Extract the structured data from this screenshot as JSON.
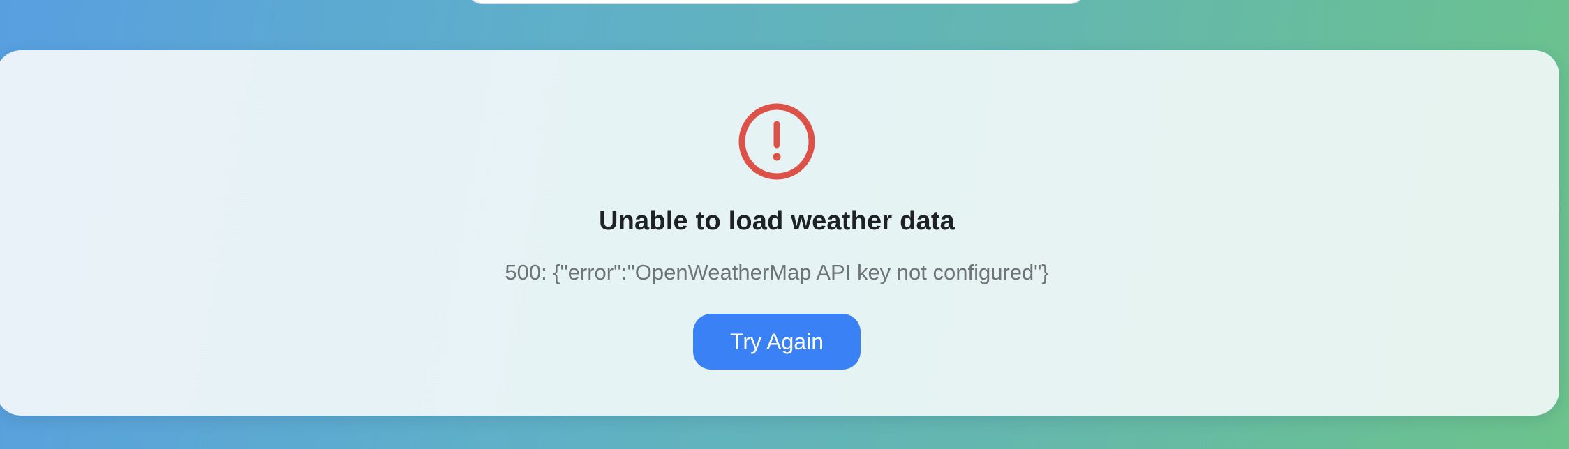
{
  "error": {
    "icon": "alert-circle-icon",
    "icon_color": "#dc5248",
    "title": "Unable to load weather data",
    "message": "500: {\"error\":\"OpenWeatherMap API key not configured\"}",
    "retry_label": "Try Again",
    "retry_color": "#3b81f6"
  }
}
